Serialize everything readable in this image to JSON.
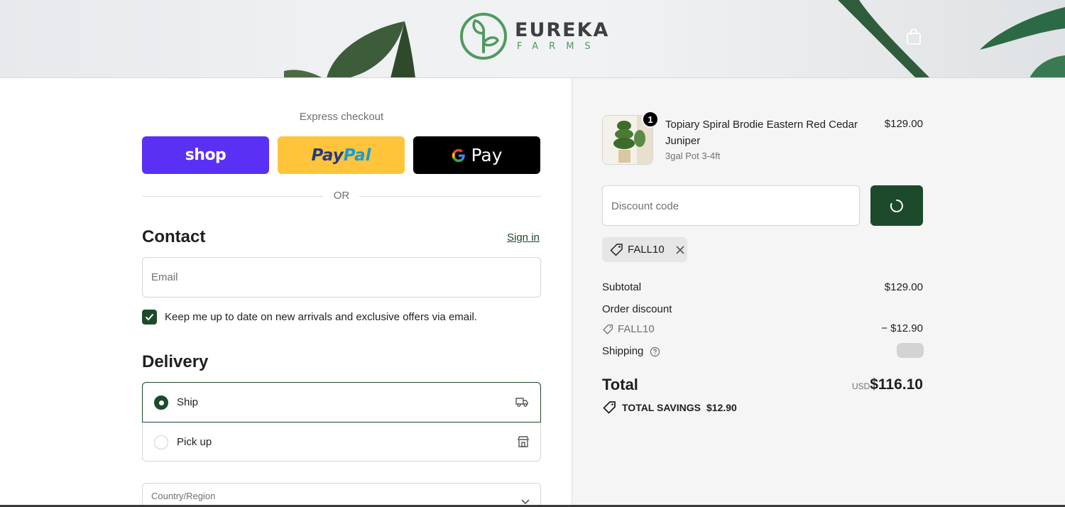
{
  "brand": {
    "name": "EUREKA",
    "sub": "FARMS"
  },
  "express": {
    "label": "Express checkout",
    "shop_label": "shop",
    "paypal_label_a": "Pay",
    "paypal_label_b": "Pal",
    "gpay_label": "Pay",
    "or_label": "OR"
  },
  "contact": {
    "title": "Contact",
    "signin_label": "Sign in",
    "email_placeholder": "Email",
    "newsletter_label": "Keep me up to date on new arrivals and exclusive offers via email.",
    "newsletter_checked": true
  },
  "delivery": {
    "title": "Delivery",
    "options": [
      {
        "label": "Ship",
        "selected": true,
        "icon": "truck-icon"
      },
      {
        "label": "Pick up",
        "selected": false,
        "icon": "store-icon"
      }
    ],
    "country_label": "Country/Region"
  },
  "summary": {
    "product": {
      "name": "Topiary Spiral Brodie Eastern Red Cedar Juniper",
      "variant": "3gal Pot 3-4ft",
      "price": "$129.00",
      "quantity": "1"
    },
    "discount_placeholder": "Discount code",
    "applied_code": "FALL10",
    "subtotal_label": "Subtotal",
    "subtotal_value": "$129.00",
    "order_discount_label": "Order discount",
    "discount_code": "FALL10",
    "discount_value": "− $12.90",
    "shipping_label": "Shipping",
    "total_label": "Total",
    "currency": "USD",
    "total_value": "$116.10",
    "savings_label": "TOTAL SAVINGS",
    "savings_value": "$12.90"
  },
  "colors": {
    "accent": "#1d4a2b",
    "shop_pay": "#5a31f4",
    "paypal": "#ffc439",
    "gpay": "#000000",
    "logo_green": "#4f9a5f"
  }
}
